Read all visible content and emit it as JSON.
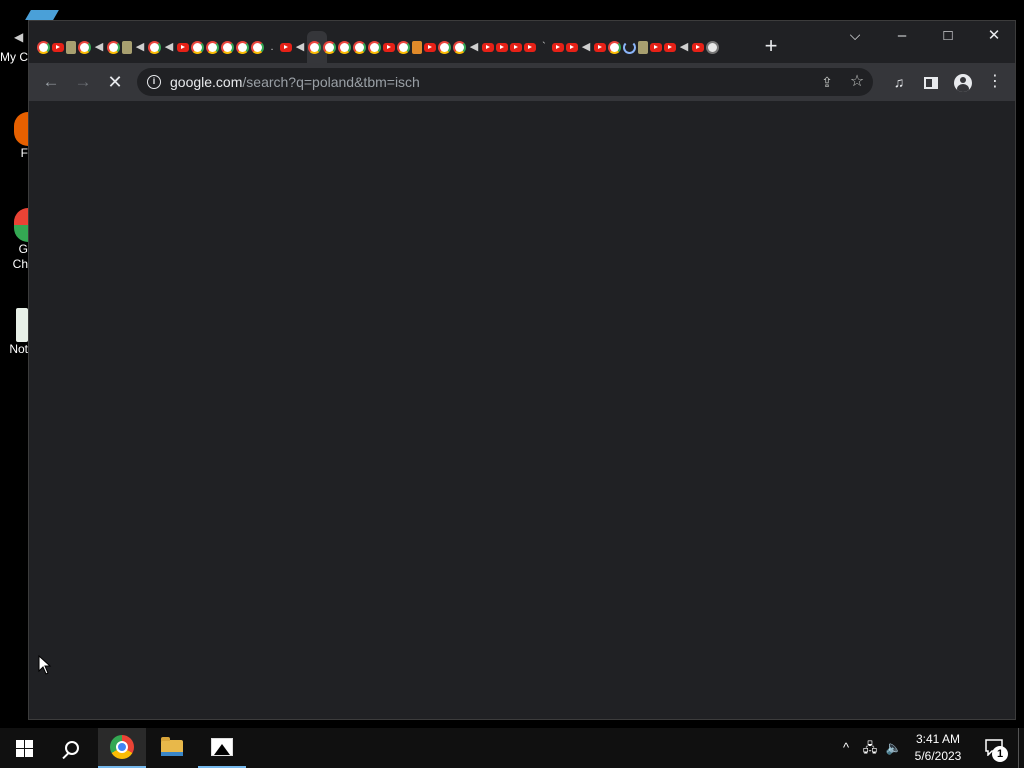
{
  "desktop": {
    "icons": [
      {
        "label": "My C",
        "kind": "my-computer"
      },
      {
        "label": "F",
        "kind": "firefox"
      },
      {
        "label": "G\nCh",
        "kind": "google-chrome"
      },
      {
        "label": "Not",
        "kind": "notepad"
      }
    ]
  },
  "browser": {
    "window_controls": {
      "minimize": "–",
      "maximize": "□",
      "close": "✕"
    },
    "tab_search_icon": "chevron-down-icon",
    "new_tab_label": "+",
    "tab_favicons": [
      "google",
      "youtube",
      "image",
      "google",
      "speaker",
      "google",
      "image",
      "speaker",
      "google",
      "speaker",
      "youtube",
      "google",
      "google",
      "google",
      "google",
      "google",
      "dot",
      "youtube",
      "speaker",
      "google",
      "google",
      "google",
      "google",
      "google",
      "youtube",
      "google",
      "burger",
      "youtube",
      "google",
      "google",
      "speaker",
      "youtube",
      "youtube",
      "youtube",
      "youtube",
      "tick",
      "youtube",
      "youtube",
      "speaker",
      "youtube",
      "google",
      "loading",
      "image",
      "youtube",
      "youtube",
      "speaker",
      "youtube",
      "white"
    ],
    "toolbar": {
      "url_host": "google.com",
      "url_path": "/search?q=poland&tbm=isch"
    }
  },
  "taskbar": {
    "apps": [
      "start",
      "search",
      "chrome",
      "file-explorer",
      "photos"
    ],
    "clock_time": "3:41 AM",
    "clock_date": "5/6/2023",
    "notification_count": "1"
  }
}
